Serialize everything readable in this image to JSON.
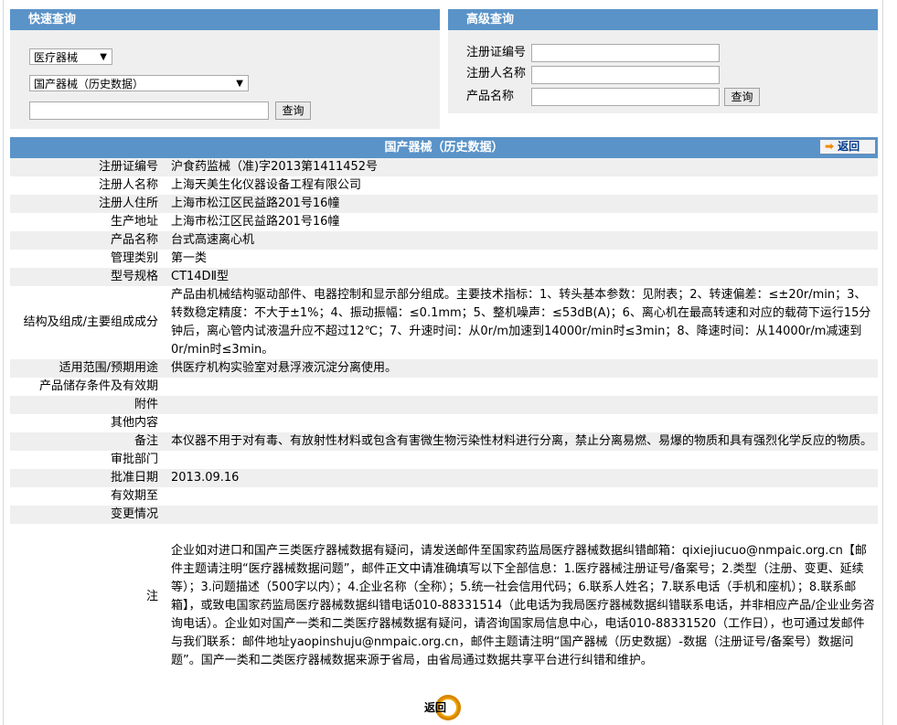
{
  "quick_search": {
    "title": "快速查询",
    "category_select": "医疗器械",
    "db_select": "国产器械（历史数据）",
    "keyword_value": "",
    "search_button": "查询"
  },
  "advanced_search": {
    "title": "高级查询",
    "fields": [
      {
        "label": "注册证编号",
        "value": ""
      },
      {
        "label": "注册人名称",
        "value": ""
      },
      {
        "label": "产品名称",
        "value": ""
      }
    ],
    "search_button": "查询"
  },
  "detail": {
    "title": "国产器械（历史数据）",
    "back_button": "返回",
    "rows": [
      {
        "key": "注册证编号",
        "value": "沪食药监械（准)字2013第1411452号"
      },
      {
        "key": "注册人名称",
        "value": "上海天美生化仪器设备工程有限公司"
      },
      {
        "key": "注册人住所",
        "value": "上海市松江区民益路201号16幢"
      },
      {
        "key": "生产地址",
        "value": "上海市松江区民益路201号16幢"
      },
      {
        "key": "产品名称",
        "value": "台式高速离心机"
      },
      {
        "key": "管理类别",
        "value": "第一类"
      },
      {
        "key": "型号规格",
        "value": "CT14DⅡ型"
      },
      {
        "key": "结构及组成/主要组成成分",
        "value": "产品由机械结构驱动部件、电器控制和显示部分组成。主要技术指标：1、转头基本参数：见附表；2、转速偏差：≤±20r/min；3、转数稳定精度：不大于±1%；4、振动振幅：≤0.1mm；5、整机噪声：≤53dB(A)；6、离心机在最高转速和对应的载荷下运行15分钟后，离心管内试液温升应不超过12℃；7、升速时间：从0r/m加速到14000r/min时≤3min；8、降速时间：从14000r/m减速到0r/min时≤3min。"
      },
      {
        "key": "适用范围/预期用途",
        "value": "供医疗机构实验室对悬浮液沉淀分离使用。"
      },
      {
        "key": "产品储存条件及有效期",
        "value": ""
      },
      {
        "key": "附件",
        "value": ""
      },
      {
        "key": "其他内容",
        "value": ""
      },
      {
        "key": "备注",
        "value": "本仪器不用于对有毒、有放射性材料或包含有害微生物污染性材料进行分离，禁止分离易燃、易爆的物质和具有强烈化学反应的物质。"
      },
      {
        "key": "审批部门",
        "value": ""
      },
      {
        "key": "批准日期",
        "value": "2013.09.16"
      },
      {
        "key": "有效期至",
        "value": ""
      },
      {
        "key": "变更情况",
        "value": ""
      },
      {
        "key": "注",
        "value": "企业如对进口和国产三类医疗器械数据有疑问，请发送邮件至国家药监局医疗器械数据纠错邮箱：qixiejiucuo@nmpaic.org.cn【邮件主题请注明“医疗器械数据问题”，邮件正文中请准确填写以下全部信息：1.医疗器械注册证号/备案号；2.类型（注册、变更、延续等）；3.问题描述（500字以内）；4.企业名称（全称）；5.统一社会信用代码；6.联系人姓名；7.联系电话（手机和座机）；8.联系邮箱】，或致电国家药监局医疗器械数据纠错电话010-88331514（此电话为我局医疗器械数据纠错联系电话，并非相应产品/企业业务咨询电话）。企业如对国产一类和二类医疗器械数据有疑问，请咨询国家局信息中心，电话010-88331520（工作日），也可通过发邮件与我们联系：邮件地址yaopinshuju@nmpaic.org.cn，邮件主题请注明“国产器械（历史数据）-数据（注册证号/备案号）数据问题”。国产一类和二类医疗器械数据来源于省局，由省局通过数据共享平台进行纠错和维护。"
      }
    ],
    "bottom_back": "返回"
  },
  "colors": {
    "header_blue": "#5a93c8",
    "panel_gray": "#efefef",
    "back_orange": "#f0a400"
  }
}
